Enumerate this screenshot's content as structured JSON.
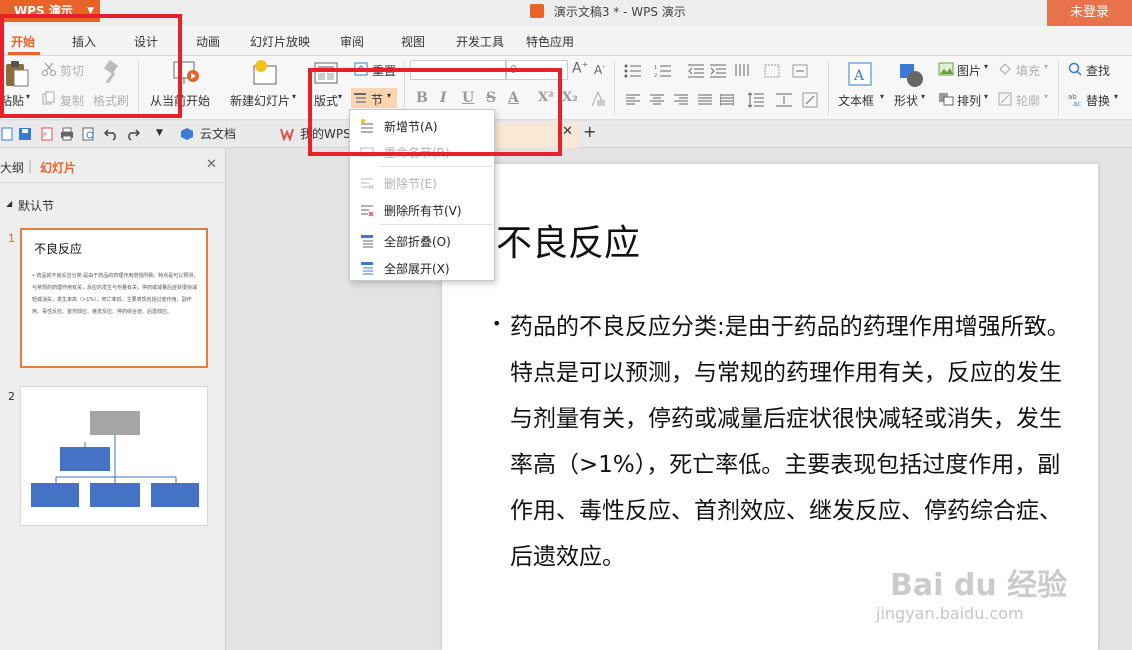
{
  "titlebar": {
    "app_button": "WPS 演示",
    "doc_title": "演示文稿3 * - WPS 演示",
    "login": "未登录"
  },
  "menu": {
    "tabs": [
      "开始",
      "插入",
      "设计",
      "动画",
      "幻灯片放映",
      "审阅",
      "视图",
      "开发工具",
      "特色应用"
    ],
    "active": "开始"
  },
  "ribbon": {
    "paste": "粘贴",
    "cut": "剪切",
    "copy": "复制",
    "format_painter": "格式刷",
    "from_current": "从当前开始",
    "new_slide": "新建幻灯片",
    "layout": "版式",
    "reset": "重置",
    "section": "节",
    "font_size_value": "0",
    "bold": "B",
    "italic": "I",
    "underline": "U",
    "strike": "S",
    "font_color": "A",
    "superscript": "X²",
    "subscript": "X₂",
    "textbox": "文本框",
    "shape": "形状",
    "picture": "图片",
    "arrange": "排列",
    "fill": "填充",
    "outline": "轮廓",
    "find": "查找",
    "replace": "替换"
  },
  "quickbar": {
    "cloud_docs": "云文档",
    "my_wps": "我的WPS"
  },
  "left_panel": {
    "tab_outline": "大纲",
    "tab_slides": "幻灯片",
    "section_name": "默认节",
    "slides": [
      {
        "number": "1",
        "title": "不良反应",
        "body": "• 药品的不良反应分类:是由于药品的药理作用增强所致。特点是可以预测，与常规的药理作用有关，反应的发生与剂量有关，停药或减量后症状很快减轻或消失，发生率高（>1%），死亡率低。主要表现包括过度作用，副作用、毒性反应、首剂效应、继发反应、停药综合症、后遗效应。"
      },
      {
        "number": "2"
      }
    ]
  },
  "slide": {
    "title": "不良反应",
    "bullet": "•",
    "body": "药品的不良反应分类:是由于药品的药理作用增强所致。特点是可以预测，与常规的药理作用有关，反应的发生与剂量有关，停药或减量后症状很快减轻或消失，发生率高（>1%），死亡率低。主要表现包括过度作用，副作用、毒性反应、首剂效应、继发反应、停药综合症、后遗效应。"
  },
  "section_menu": {
    "items": [
      {
        "label": "新增节(A)",
        "enabled": true,
        "icon": "add-section-icon"
      },
      {
        "label": "重命名节(R)",
        "enabled": false,
        "icon": "rename-section-icon"
      },
      {
        "label": "删除节(E)",
        "enabled": false,
        "icon": "delete-section-icon"
      },
      {
        "label": "删除所有节(V)",
        "enabled": true,
        "icon": "delete-all-sections-icon"
      },
      {
        "label": "全部折叠(O)",
        "enabled": true,
        "icon": "collapse-all-icon"
      },
      {
        "label": "全部展开(X)",
        "enabled": true,
        "icon": "expand-all-icon"
      }
    ]
  },
  "watermark": {
    "brand": "Bai du 经验",
    "url": "jingyan.baidu.com"
  },
  "colors": {
    "accent": "#e8632a",
    "highlight_box": "#e8202a",
    "selected_thumb_border": "#e07f3e",
    "diagram_box_blue": "#4472c4",
    "diagram_box_gray": "#a5a5a5"
  }
}
